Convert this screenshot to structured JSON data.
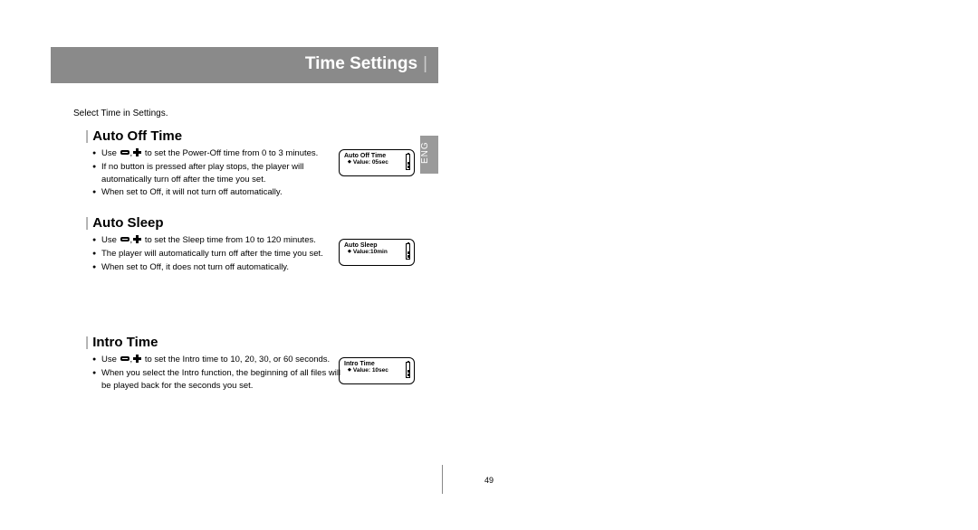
{
  "page": {
    "title": "Time Settings",
    "lang": "ENG",
    "intro": "Select Time in Settings.",
    "number": "49"
  },
  "sections": {
    "auto_off": {
      "title": "Auto Off Time",
      "b1a": "Use ",
      "b1b": " to set the Power-Off time from 0 to 3 minutes.",
      "b2": "If no button is pressed after play stops, the player will automatically turn off after the time you set.",
      "b3": "When set to Off, it will not turn off automatically.",
      "screen_title": "Auto Off Time",
      "screen_value": "Value: 05sec"
    },
    "auto_sleep": {
      "title": "Auto Sleep",
      "b1a": "Use ",
      "b1b": " to set the Sleep time from 10 to 120 minutes.",
      "b2": "The player will automatically turn off after the time you set.",
      "b3": "When set to Off, it does not turn off automatically.",
      "screen_title": "Auto Sleep",
      "screen_value": "Value:10min"
    },
    "intro_time": {
      "title": "Intro Time",
      "b1a": "Use ",
      "b1b": " to set the Intro time to 10, 20, 30, or 60 seconds.",
      "b2": "When you select the Intro function, the beginning of all files will be played back for the seconds you set.",
      "screen_title": "Intro Time",
      "screen_value": "Value: 10sec"
    }
  }
}
